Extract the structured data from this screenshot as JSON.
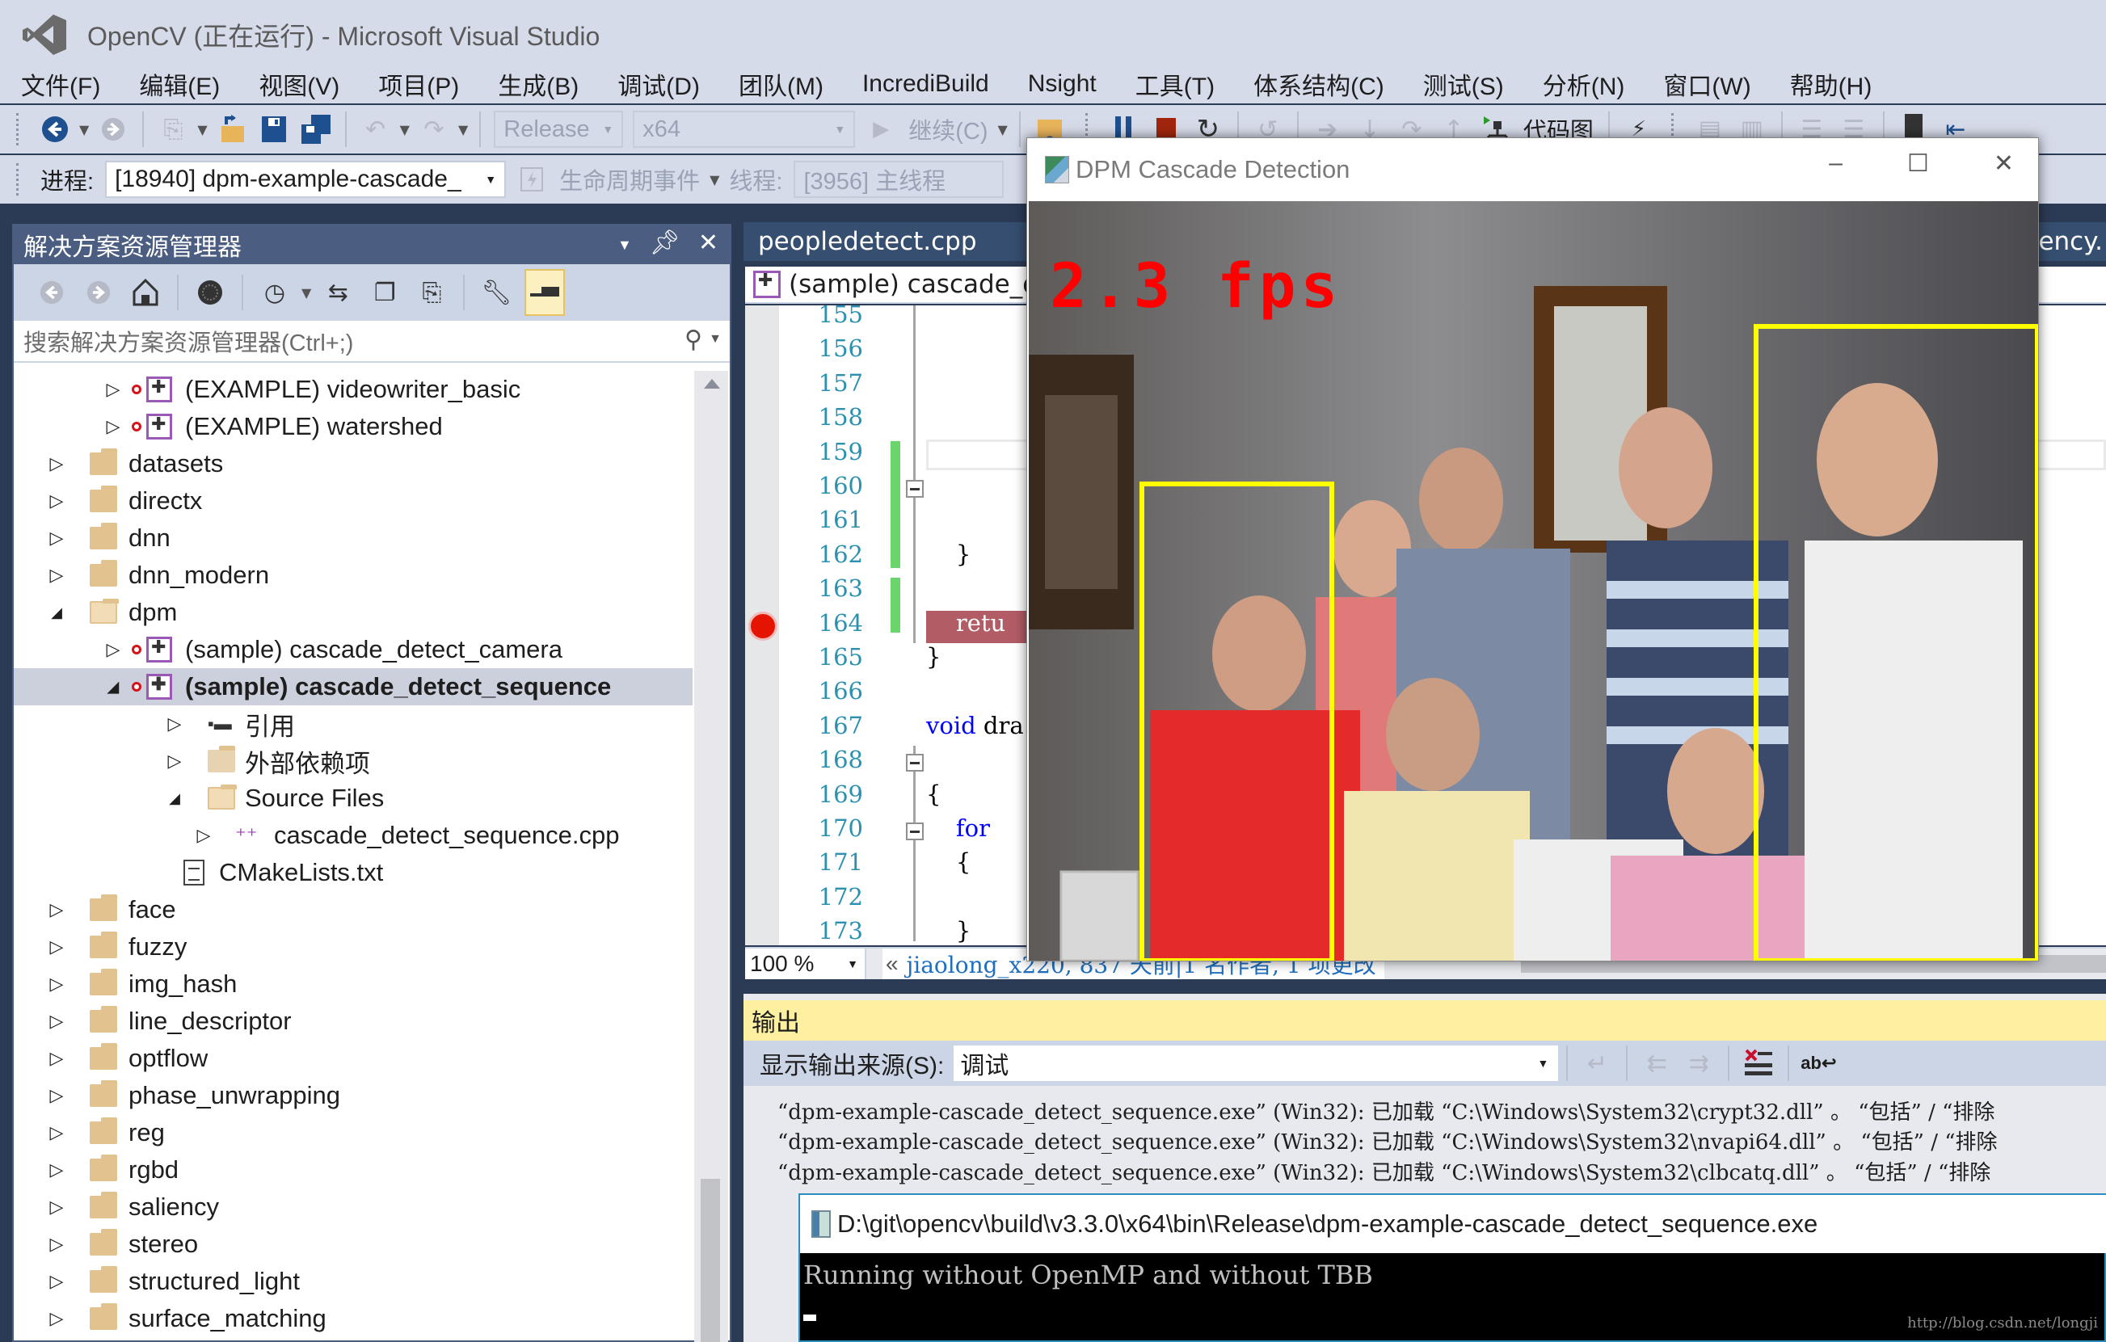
{
  "window": {
    "title": "OpenCV (正在运行) - Microsoft Visual Studio"
  },
  "menu": [
    "文件(F)",
    "编辑(E)",
    "视图(V)",
    "项目(P)",
    "生成(B)",
    "调试(D)",
    "团队(M)",
    "IncrediBuild",
    "Nsight",
    "工具(T)",
    "体系结构(C)",
    "测试(S)",
    "分析(N)",
    "窗口(W)",
    "帮助(H)"
  ],
  "toolbar1": {
    "configuration": "Release",
    "platform": "x64",
    "continue_label": "继续(C)",
    "code_map_label": "代码图"
  },
  "toolbar2": {
    "process_label": "进程:",
    "process_value": "[18940] dpm-example-cascade_",
    "lifecycle_label": "生命周期事件",
    "thread_label": "线程:",
    "thread_value": "[3956] 主线程"
  },
  "solution_explorer": {
    "title": "解决方案资源管理器",
    "search_placeholder": "搜索解决方案资源管理器(Ctrl+;)",
    "tree": [
      {
        "label": "(EXAMPLE) videowriter_basic",
        "type": "project",
        "level": 2,
        "state": "collapsed"
      },
      {
        "label": "(EXAMPLE) watershed",
        "type": "project",
        "level": 2,
        "state": "collapsed"
      },
      {
        "label": "datasets",
        "type": "folder",
        "level": 1,
        "state": "collapsed"
      },
      {
        "label": "directx",
        "type": "folder",
        "level": 1,
        "state": "collapsed"
      },
      {
        "label": "dnn",
        "type": "folder",
        "level": 1,
        "state": "collapsed"
      },
      {
        "label": "dnn_modern",
        "type": "folder",
        "level": 1,
        "state": "collapsed"
      },
      {
        "label": "dpm",
        "type": "folder-open",
        "level": 1,
        "state": "expanded"
      },
      {
        "label": "(sample) cascade_detect_camera",
        "type": "project",
        "level": 2,
        "state": "collapsed"
      },
      {
        "label": "(sample) cascade_detect_sequence",
        "type": "project",
        "level": 2,
        "state": "expanded",
        "selected": true
      },
      {
        "label": "引用",
        "type": "references",
        "level": 3,
        "state": "collapsed"
      },
      {
        "label": "外部依赖项",
        "type": "external",
        "level": 3,
        "state": "collapsed"
      },
      {
        "label": "Source Files",
        "type": "filter",
        "level": 3,
        "state": "expanded"
      },
      {
        "label": "cascade_detect_sequence.cpp",
        "type": "cpp",
        "level": 4,
        "state": "collapsed"
      },
      {
        "label": "CMakeLists.txt",
        "type": "txt",
        "level": 3,
        "state": "none"
      },
      {
        "label": "face",
        "type": "folder",
        "level": 1,
        "state": "collapsed"
      },
      {
        "label": "fuzzy",
        "type": "folder",
        "level": 1,
        "state": "collapsed"
      },
      {
        "label": "img_hash",
        "type": "folder",
        "level": 1,
        "state": "collapsed"
      },
      {
        "label": "line_descriptor",
        "type": "folder",
        "level": 1,
        "state": "collapsed"
      },
      {
        "label": "optflow",
        "type": "folder",
        "level": 1,
        "state": "collapsed"
      },
      {
        "label": "phase_unwrapping",
        "type": "folder",
        "level": 1,
        "state": "collapsed"
      },
      {
        "label": "reg",
        "type": "folder",
        "level": 1,
        "state": "collapsed"
      },
      {
        "label": "rgbd",
        "type": "folder",
        "level": 1,
        "state": "collapsed"
      },
      {
        "label": "saliency",
        "type": "folder",
        "level": 1,
        "state": "collapsed"
      },
      {
        "label": "stereo",
        "type": "folder",
        "level": 1,
        "state": "collapsed"
      },
      {
        "label": "structured_light",
        "type": "folder",
        "level": 1,
        "state": "collapsed"
      },
      {
        "label": "surface_matching",
        "type": "folder",
        "level": 1,
        "state": "collapsed"
      }
    ]
  },
  "editor": {
    "tabs": [
      {
        "label": "peopledetect.cpp"
      },
      {
        "label": "liency."
      }
    ],
    "nav_project": "(sample) cascade_de",
    "lines": [
      {
        "num": "155",
        "code": ""
      },
      {
        "num": "156",
        "code": ""
      },
      {
        "num": "157",
        "code": ""
      },
      {
        "num": "158",
        "code": ""
      },
      {
        "num": "159",
        "code": ""
      },
      {
        "num": "160",
        "code": ""
      },
      {
        "num": "161",
        "code": ""
      },
      {
        "num": "162",
        "code": "    }"
      },
      {
        "num": "163",
        "code": ""
      },
      {
        "num": "164",
        "code": "    retu"
      },
      {
        "num": "165",
        "code": "}"
      },
      {
        "num": "166",
        "code": ""
      },
      {
        "num": "167",
        "code": "void dra"
      },
      {
        "num": "168",
        "code": ""
      },
      {
        "num": "169",
        "code": "{"
      },
      {
        "num": "170",
        "code": "    for"
      },
      {
        "num": "171",
        "code": "    {"
      },
      {
        "num": "172",
        "code": ""
      },
      {
        "num": "173",
        "code": "    }"
      }
    ],
    "breakpoint_line": "164",
    "zoom": "100 %",
    "codelens": "jiaolong_x220, 837 天前|1 名作者, 1 项更改"
  },
  "output": {
    "title": "输出",
    "source_label": "显示输出来源(S):",
    "source_value": "调试",
    "lines": [
      "“dpm-example-cascade_detect_sequence.exe” (Win32): 已加载 “C:\\Windows\\System32\\crypt32.dll” 。 “包括” / “排除",
      "“dpm-example-cascade_detect_sequence.exe” (Win32): 已加载 “C:\\Windows\\System32\\nvapi64.dll” 。 “包括” / “排除",
      "“dpm-example-cascade_detect_sequence.exe” (Win32): 已加载 “C:\\Windows\\System32\\clbcatq.dll” 。 “包括” / “排除"
    ]
  },
  "console": {
    "title": "D:\\git\\opencv\\build\\v3.3.0\\x64\\bin\\Release\\dpm-example-cascade_detect_sequence.exe",
    "text": "Running without OpenMP and without TBB",
    "watermark": "http://blog.csdn.net/longji"
  },
  "dpm_window": {
    "title": "DPM Cascade Detection",
    "fps": "2.3 fps",
    "detection_color": "#ffff00",
    "fps_color": "#ff0000",
    "detections": 2
  },
  "colors": {
    "chrome": "#d6dbe9",
    "panel_header": "#4b5e82",
    "output_header": "#fdf0a0",
    "breakpoint": "#e51400",
    "line_numbers": "#2b91af"
  }
}
